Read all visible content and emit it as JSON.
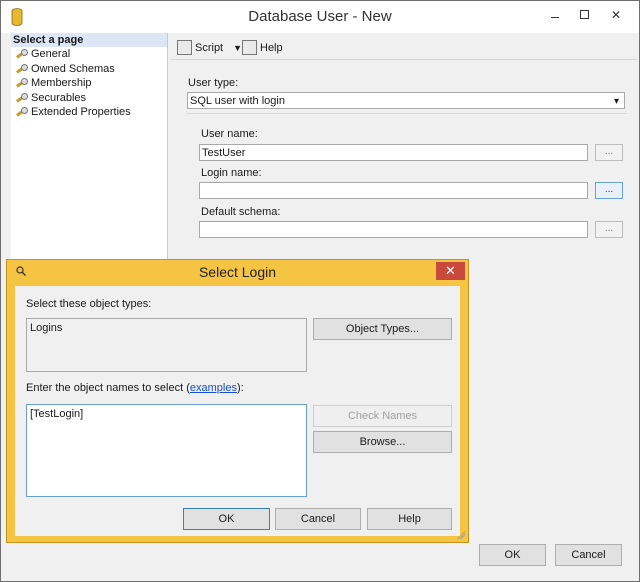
{
  "window": {
    "title": "Database User - New"
  },
  "left_pane": {
    "header": "Select a page",
    "items": [
      "General",
      "Owned Schemas",
      "Membership",
      "Securables",
      "Extended Properties"
    ]
  },
  "toolbar": {
    "script_label": "Script",
    "help_label": "Help"
  },
  "form": {
    "user_type_label": "User type:",
    "user_type_value": "SQL user with login",
    "user_name_label": "User name:",
    "user_name_value": "TestUser",
    "login_name_label": "Login name:",
    "login_name_value": "",
    "default_schema_label": "Default schema:",
    "default_schema_value": "",
    "browse_label": "..."
  },
  "bottom": {
    "ok_label": "OK",
    "cancel_label": "Cancel"
  },
  "dialog": {
    "title": "Select Login",
    "close_label": "✕",
    "object_types_label": "Select these object types:",
    "object_types_value": "Logins",
    "object_types_button": "Object Types...",
    "names_label_prefix": "Enter the object names to select (",
    "names_label_link": "examples",
    "names_label_suffix": "):",
    "names_value": "[TestLogin]",
    "check_names_button": "Check Names",
    "browse_button": "Browse...",
    "ok_button": "OK",
    "cancel_button": "Cancel",
    "help_button": "Help"
  }
}
